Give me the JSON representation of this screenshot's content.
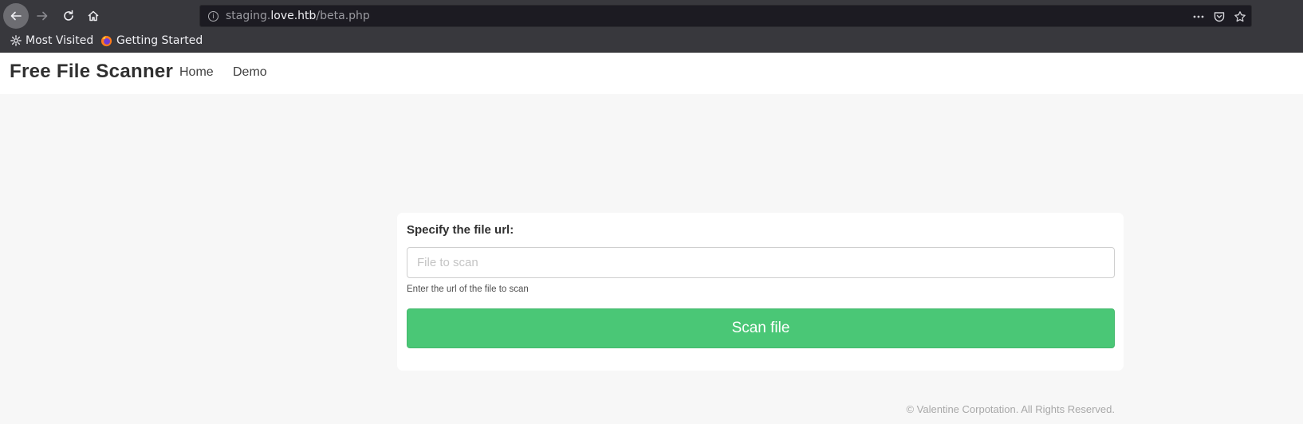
{
  "browser": {
    "url_prefix": "staging.",
    "url_domain": "love.htb",
    "url_path": "/beta.php",
    "bookmarks": [
      {
        "label": "Most Visited",
        "icon": "gear-icon"
      },
      {
        "label": "Getting Started",
        "icon": "firefox-icon"
      }
    ]
  },
  "navbar": {
    "brand": "Free File Scanner",
    "links": [
      "Home",
      "Demo"
    ]
  },
  "form": {
    "label": "Specify the file url:",
    "placeholder": "File to scan",
    "value": "",
    "help": "Enter the url of the file to scan",
    "button": "Scan file",
    "button_color": "#4ac776"
  },
  "footer": {
    "text": "© Valentine Corpotation. All Rights Reserved."
  }
}
